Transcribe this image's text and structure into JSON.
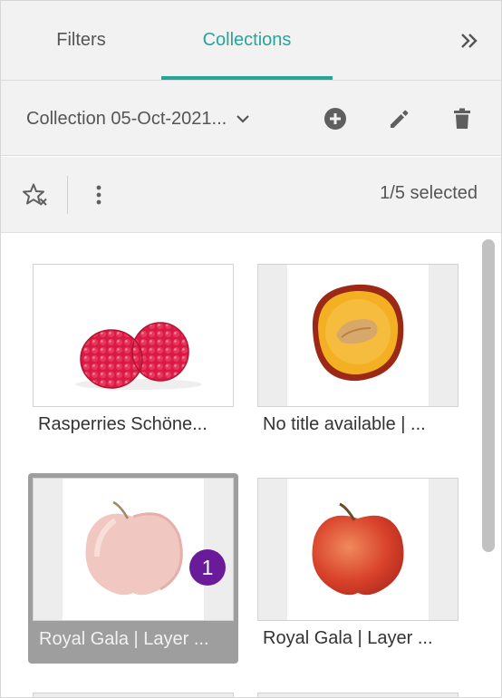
{
  "tabs": {
    "filters": "Filters",
    "collections": "Collections",
    "active": "collections"
  },
  "collection": {
    "name": "Collection 05-Oct-2021..."
  },
  "toolbar": {
    "selected_count": "1/5 selected"
  },
  "items": [
    {
      "caption": "Rasperries Schöne...",
      "selected": false,
      "image": "raspberries"
    },
    {
      "caption": "No title available | ...",
      "selected": false,
      "image": "plum-half"
    },
    {
      "caption": "Royal Gala | Layer ...",
      "selected": true,
      "badge": "1",
      "image": "apple-faded"
    },
    {
      "caption": "Royal Gala | Layer ...",
      "selected": false,
      "image": "apple-red"
    }
  ],
  "colors": {
    "accent": "#26a59a",
    "badge": "#6a1b9a",
    "selected_bg": "#9e9e9e"
  },
  "icons": [
    "chevrons-right-icon",
    "chevron-down-icon",
    "add-circle-icon",
    "pencil-icon",
    "trash-icon",
    "star-remove-icon",
    "more-vertical-icon"
  ]
}
